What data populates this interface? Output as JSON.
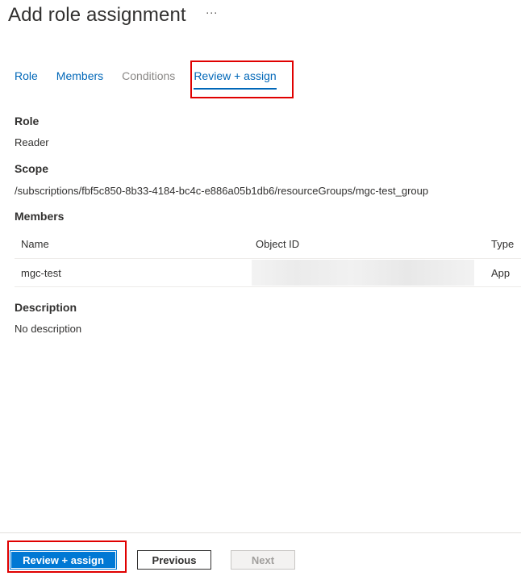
{
  "header": {
    "title": "Add role assignment",
    "more_label": "···"
  },
  "tabs": [
    {
      "label": "Role",
      "state": "link"
    },
    {
      "label": "Members",
      "state": "link"
    },
    {
      "label": "Conditions",
      "state": "disabled"
    },
    {
      "label": "Review + assign",
      "state": "active"
    }
  ],
  "role": {
    "label": "Role",
    "value": "Reader"
  },
  "scope": {
    "label": "Scope",
    "value": "/subscriptions/fbf5c850-8b33-4184-bc4c-e886a05b1db6/resourceGroups/mgc-test_group"
  },
  "members": {
    "label": "Members",
    "columns": [
      "Name",
      "Object ID",
      "Type"
    ],
    "rows": [
      {
        "name": "mgc-test",
        "object_id": "",
        "type": "App"
      }
    ]
  },
  "description": {
    "label": "Description",
    "value": "No description"
  },
  "footer": {
    "primary_label": "Review + assign",
    "previous_label": "Previous",
    "next_label": "Next"
  },
  "colors": {
    "accent": "#0078d4",
    "link": "#0067b8",
    "highlight": "#e00000"
  }
}
